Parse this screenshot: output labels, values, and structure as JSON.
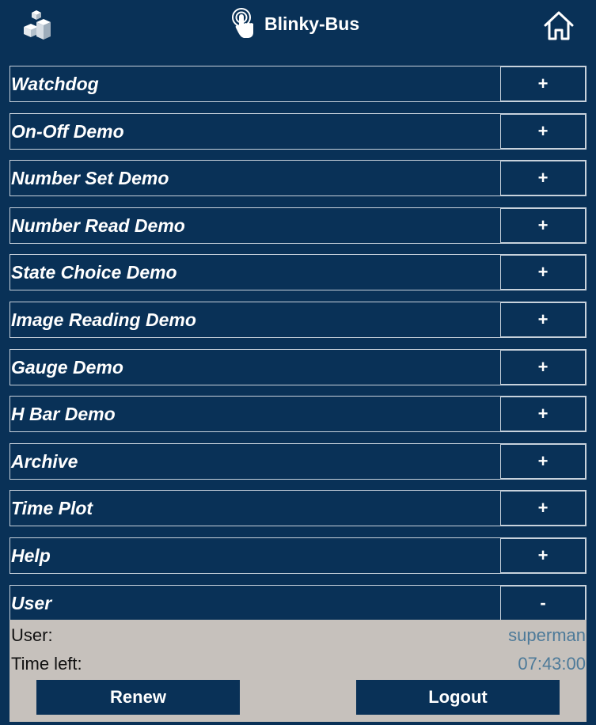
{
  "header": {
    "title": "Blinky-Bus",
    "logo_icon": "cube-logo-icon",
    "title_icon": "touch-hand-icon",
    "home_icon": "home-icon"
  },
  "colors": {
    "background": "#093157",
    "text": "#ffffff",
    "border": "#c8d2dc",
    "panel": "#c6c1bc",
    "value_text": "#4d7a99"
  },
  "menu": [
    {
      "label": "Watchdog",
      "toggle": "+"
    },
    {
      "label": "On-Off Demo",
      "toggle": "+"
    },
    {
      "label": "Number Set Demo",
      "toggle": "+"
    },
    {
      "label": "Number Read Demo",
      "toggle": "+"
    },
    {
      "label": "State Choice Demo",
      "toggle": "+"
    },
    {
      "label": "Image Reading Demo",
      "toggle": "+"
    },
    {
      "label": "Gauge Demo",
      "toggle": "+"
    },
    {
      "label": "H Bar Demo",
      "toggle": "+"
    },
    {
      "label": "Archive",
      "toggle": "+"
    },
    {
      "label": "Time Plot",
      "toggle": "+"
    },
    {
      "label": "Help",
      "toggle": "+"
    },
    {
      "label": "User",
      "toggle": "-"
    }
  ],
  "user_panel": {
    "user_label": "User:",
    "user_value": "superman",
    "time_label": "Time left:",
    "time_value": "07:43:00",
    "renew_label": "Renew",
    "logout_label": "Logout"
  }
}
